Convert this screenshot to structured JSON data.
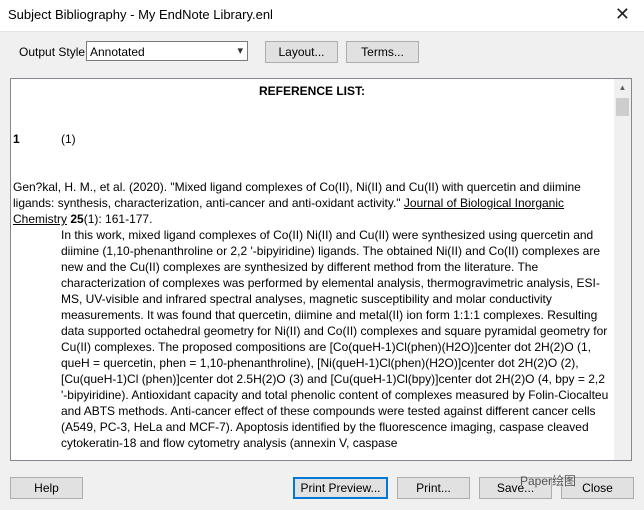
{
  "window": {
    "title": "Subject Bibliography - My EndNote Library.enl",
    "close_glyph": "✕"
  },
  "toolbar": {
    "output_style_label": "Output Style:",
    "output_style_value": "Annotated",
    "layout_label": "Layout...",
    "terms_label": "Terms..."
  },
  "document": {
    "heading": "REFERENCE LIST:",
    "ref_number": "1",
    "ref_id": "(1)",
    "citation": {
      "authors_year_title": "Gen?kal, H. M., et al. (2020). \"Mixed ligand complexes of Co(II), Ni(II) and Cu(II) with quercetin and diimine ligands: synthesis, characterization, anti-cancer and anti-oxidant activity.\" ",
      "journal": "Journal of Biological Inorganic Chemistry",
      "volume": "25",
      "issue_pages": "(1): 161-177."
    },
    "abstract": "In this work, mixed ligand complexes of Co(II) Ni(II) and Cu(II) were synthesized using quercetin and diimine (1,10-phenanthroline or 2,2 '-bipyiridine) ligands. The obtained Ni(II) and Co(II) complexes are new and the Cu(II) complexes are synthesized by different method from the literature. The characterization of complexes was performed by elemental analysis, thermogravimetric analysis, ESI-MS, UV-visible and infrared spectral analyses, magnetic susceptibility and molar conductivity measurements. It was found that quercetin, diimine and metal(II) ion form 1:1:1 complexes. Resulting data supported octahedral geometry for Ni(II) and Co(II) complexes and square pyramidal geometry for Cu(II) complexes. The proposed compositions are [Co(queH-1)Cl(phen)(H2O)]center dot 2H(2)O (1, queH = quercetin, phen = 1,10-phenanthroline), [Ni(queH-1)Cl(phen)(H2O)]center dot 2H(2)O (2), [Cu(queH-1)Cl (phen)]center dot 2.5H(2)O (3) and [Cu(queH-1)Cl(bpy)]center dot 2H(2)O (4, bpy = 2,2 '-bipyiridine). Antioxidant capacity and total phenolic content of complexes measured by Folin-Ciocalteu and ABTS methods. Anti-cancer effect of these compounds were tested against different cancer cells (A549, PC-3, HeLa and MCF-7). Apoptosis identified by the fluorescence imaging, caspase cleaved cytokeratin-18 and flow cytometry analysis (annexin V, caspase"
  },
  "buttons": {
    "help": "Help",
    "print_preview": "Print Preview...",
    "print": "Print...",
    "save": "Save...",
    "close": "Close"
  },
  "watermark": "Paper绘图",
  "icons": {
    "dropdown": "▾",
    "scroll_up": "▲"
  }
}
